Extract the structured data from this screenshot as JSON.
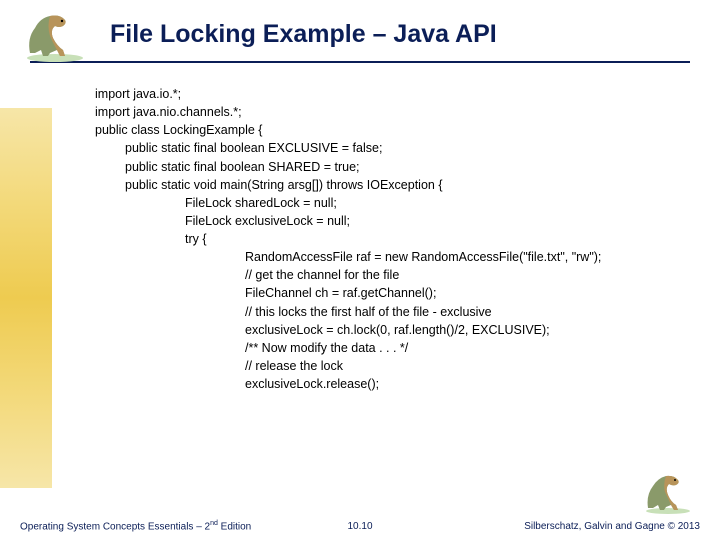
{
  "slide": {
    "title": "File Locking Example – Java API"
  },
  "code": {
    "l0": "import java.io.*;",
    "l1": "import java.nio.channels.*;",
    "l2": "public class LockingExample {",
    "l3": "public static final boolean EXCLUSIVE = false;",
    "l4": "public static final boolean SHARED = true;",
    "l5": "public static void main(String arsg[]) throws IOException {",
    "l6": "FileLock sharedLock = null;",
    "l7": "FileLock exclusiveLock = null;",
    "l8": "try {",
    "l9": "RandomAccessFile raf = new RandomAccessFile(\"file.txt\", \"rw\");",
    "l10": "// get the channel for the file",
    "l11": "FileChannel ch = raf.getChannel();",
    "l12": "// this locks the first half of the file - exclusive",
    "l13": "exclusiveLock = ch.lock(0, raf.length()/2, EXCLUSIVE);",
    "l14": "/** Now modify the data . . . */",
    "l15": "// release the lock",
    "l16": "exclusiveLock.release();"
  },
  "footer": {
    "left_a": "Operating System Concepts Essentials – 2",
    "left_sup": "nd",
    "left_b": " Edition",
    "center": "10.10",
    "right": "Silberschatz, Galvin and Gagne © 2013"
  }
}
